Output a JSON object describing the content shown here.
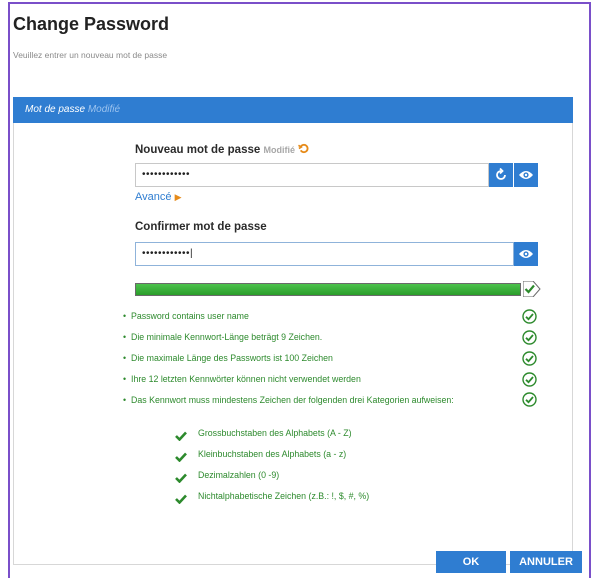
{
  "dialog": {
    "title": "Change Password",
    "subtitle": "Veuillez entrer un nouveau mot de passe"
  },
  "section": {
    "title": "Mot de passe",
    "status": "Modifié"
  },
  "new_password": {
    "label": "Nouveau mot de passe",
    "status": "Modifié",
    "undo_icon": "undo-icon",
    "value": "••••••••••••"
  },
  "advanced": {
    "label": "Avancé",
    "arrow_icon": "triangle-right-icon"
  },
  "confirm_password": {
    "label": "Confirmer mot de passe",
    "value": "••••••••••••|"
  },
  "strength": {
    "level": 1.0,
    "color": "#33a833"
  },
  "rules": [
    {
      "text": "Password contains user name"
    },
    {
      "text": "Die minimale Kennwort-Länge beträgt 9 Zeichen."
    },
    {
      "text": "Die maximale Länge des Passworts ist 100 Zeichen"
    },
    {
      "text": "Ihre 12 letzten Kennwörter können nicht verwendet werden"
    },
    {
      "text": "Das Kennwort muss mindestens Zeichen der folgenden drei Kategorien aufweisen:"
    }
  ],
  "categories": [
    {
      "text": "Grossbuchstaben des Alphabets (A - Z)"
    },
    {
      "text": "Kleinbuchstaben des Alphabets (a - z)"
    },
    {
      "text": "Dezimalzahlen (0 -9)"
    },
    {
      "text": "Nichtalphabetische Zeichen (z.B.: !, $, #, %)"
    }
  ],
  "buttons": {
    "ok": "OK",
    "cancel": "ANNULER"
  },
  "colors": {
    "accent": "#2f7dd1",
    "success": "#2d8a2d",
    "warning": "#e68b1a",
    "frame": "#7a4fc9"
  }
}
